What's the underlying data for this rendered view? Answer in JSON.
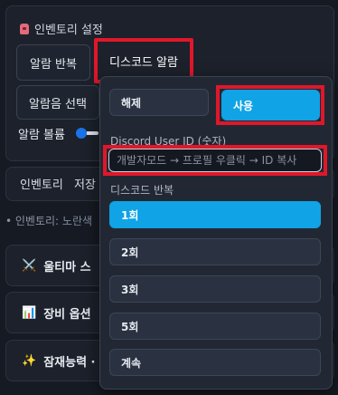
{
  "settings": {
    "title": "인벤토리 설정",
    "tab_repeat": "알람 반복",
    "tab_discord": "디스코드 알람",
    "sound_select": "알람음 선택",
    "volume_label": "알람 볼륨"
  },
  "inventory": {
    "label": "인벤토리",
    "save": "저장",
    "note_prefix": "• 인벤토리: ",
    "note_accent": "노란색"
  },
  "accordions": [
    {
      "icon": "crossed-swords-icon",
      "glyph": "⚔️",
      "label": "울티마 스"
    },
    {
      "icon": "bar-chart-icon",
      "glyph": "📊",
      "label": "장비 옵션"
    },
    {
      "icon": "sparkles-icon",
      "glyph": "✨",
      "label": "잠재능력 ·"
    }
  ],
  "popup": {
    "off_label": "해제",
    "on_label": "사용",
    "user_id_label": "Discord User ID (숫자)",
    "user_id_placeholder": "개발자모드 → 프로필 우클릭 → ID 복사",
    "user_id_value": "",
    "repeat_label": "디스코드 반복",
    "repeat_options": [
      "1회",
      "2회",
      "3회",
      "5회",
      "계속"
    ],
    "selected_repeat": "1회",
    "selected_mode": "사용"
  },
  "colors": {
    "accent": "#10a3e5",
    "highlight_frame": "#e0172a",
    "background": "#161a22"
  }
}
